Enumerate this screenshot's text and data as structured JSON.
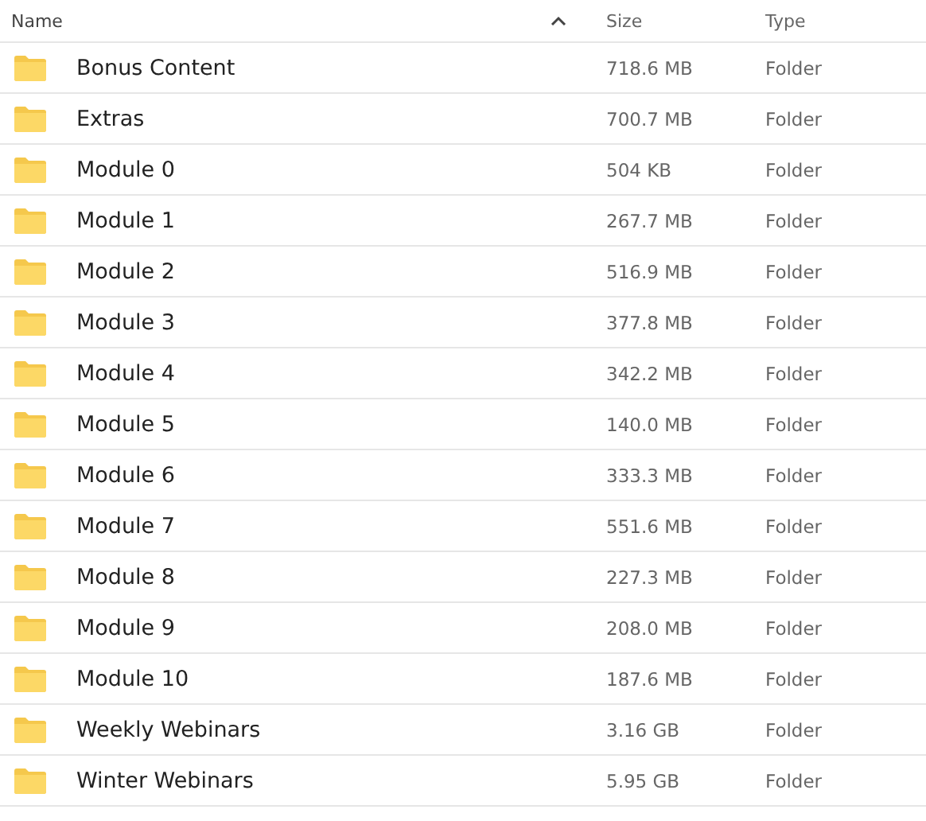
{
  "table": {
    "columns": [
      {
        "label": "Name",
        "sorted": true
      },
      {
        "label": "Size",
        "sorted": false
      },
      {
        "label": "Type",
        "sorted": false
      }
    ],
    "rows": [
      {
        "name": "Bonus Content",
        "size": "718.6 MB",
        "type": "Folder"
      },
      {
        "name": "Extras",
        "size": "700.7 MB",
        "type": "Folder"
      },
      {
        "name": "Module 0",
        "size": "504 KB",
        "type": "Folder"
      },
      {
        "name": "Module 1",
        "size": "267.7 MB",
        "type": "Folder"
      },
      {
        "name": "Module 2",
        "size": "516.9 MB",
        "type": "Folder"
      },
      {
        "name": "Module 3",
        "size": "377.8 MB",
        "type": "Folder"
      },
      {
        "name": "Module 4",
        "size": "342.2 MB",
        "type": "Folder"
      },
      {
        "name": "Module 5",
        "size": "140.0 MB",
        "type": "Folder"
      },
      {
        "name": "Module 6",
        "size": "333.3 MB",
        "type": "Folder"
      },
      {
        "name": "Module 7",
        "size": "551.6 MB",
        "type": "Folder"
      },
      {
        "name": "Module 8",
        "size": "227.3 MB",
        "type": "Folder"
      },
      {
        "name": "Module 9",
        "size": "208.0 MB",
        "type": "Folder"
      },
      {
        "name": "Module 10",
        "size": "187.6 MB",
        "type": "Folder"
      },
      {
        "name": "Weekly Webinars",
        "size": "3.16 GB",
        "type": "Folder"
      },
      {
        "name": "Winter Webinars",
        "size": "5.95 GB",
        "type": "Folder"
      }
    ]
  }
}
